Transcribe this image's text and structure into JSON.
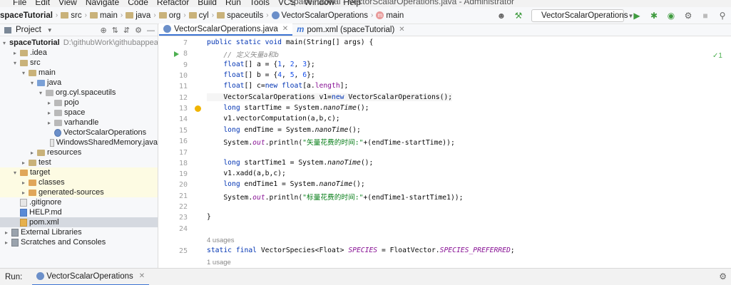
{
  "menu": {
    "items": [
      "File",
      "Edit",
      "View",
      "Navigate",
      "Code",
      "Refactor",
      "Build",
      "Run",
      "Tools",
      "VCS",
      "Window",
      "Help"
    ],
    "window_title": "spaceTutorial - VectorScalarOperations.java - Administrator"
  },
  "breadcrumb": {
    "items": [
      "spaceTutorial",
      "src",
      "main",
      "java",
      "org",
      "cyl",
      "spaceutils",
      "VectorScalarOperations",
      "main"
    ]
  },
  "toolbar": {
    "run_config": "VectorScalarOperations"
  },
  "project_pane": {
    "title": "Project",
    "tree": [
      {
        "label": "spaceTutorial",
        "path": "D:\\githubWork\\githubappearan",
        "bold": true
      },
      {
        "label": ".idea"
      },
      {
        "label": "src"
      },
      {
        "label": "main"
      },
      {
        "label": "java"
      },
      {
        "label": "org.cyl.spaceutils"
      },
      {
        "label": "pojo"
      },
      {
        "label": "space"
      },
      {
        "label": "varhandle"
      },
      {
        "label": "VectorScalarOperations"
      },
      {
        "label": "WindowsSharedMemory.java"
      },
      {
        "label": "resources"
      },
      {
        "label": "test"
      },
      {
        "label": "target"
      },
      {
        "label": "classes"
      },
      {
        "label": "generated-sources"
      },
      {
        "label": ".gitignore"
      },
      {
        "label": "HELP.md"
      },
      {
        "label": "pom.xml"
      },
      {
        "label": "External Libraries"
      },
      {
        "label": "Scratches and Consoles"
      }
    ]
  },
  "editor": {
    "tabs": [
      {
        "label": "VectorScalarOperations.java",
        "active": true
      },
      {
        "label": "pom.xml (spaceTutorial)",
        "active": false
      }
    ],
    "line_numbers": [
      "7",
      "8",
      "9",
      "10",
      "11",
      "12",
      "13",
      "14",
      "15",
      "16",
      "17",
      "18",
      "19",
      "20",
      "21",
      "22",
      "23",
      "24",
      "25"
    ],
    "hints": {
      "usages_4": "4 usages",
      "usages_1": "1 usage"
    },
    "inspection": "✓1"
  },
  "run_panel": {
    "label": "Run:",
    "tab": "VectorScalarOperations"
  },
  "colors": {
    "accent": "#3d74d3",
    "keyword": "#0033b3",
    "number": "#1750eb",
    "string": "#067d17",
    "comment": "#8c8c8c",
    "field": "#871094"
  }
}
